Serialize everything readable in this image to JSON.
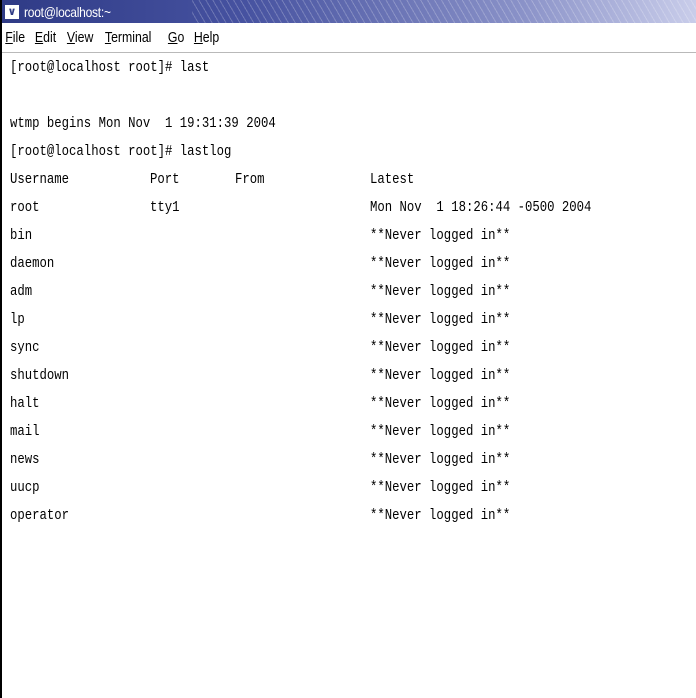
{
  "window": {
    "title": "root@localhost:~",
    "menu_icon": "chevron-down-icon"
  },
  "menubar": {
    "items": [
      {
        "label": "File",
        "mnemonic": "F",
        "rest": "ile"
      },
      {
        "label": "Edit",
        "mnemonic": "E",
        "rest": "dit"
      },
      {
        "label": "View",
        "mnemonic": "V",
        "rest": "iew"
      },
      {
        "label": "Terminal",
        "mnemonic": "T",
        "rest": "erminal"
      },
      {
        "label": "Go",
        "mnemonic": "G",
        "rest": "o"
      },
      {
        "label": "Help",
        "mnemonic": "H",
        "rest": "elp"
      }
    ]
  },
  "terminal": {
    "line1": "[root@localhost root]# last",
    "line2": "",
    "line3": "wtmp begins Mon Nov  1 19:31:39 2004",
    "line4": "[root@localhost root]# lastlog",
    "table": {
      "headers": {
        "username": "Username",
        "port": "Port",
        "from": "From",
        "latest": "Latest"
      },
      "rows": [
        {
          "username": "root",
          "port": "tty1",
          "from": "",
          "latest": "Mon Nov  1 18:26:44 -0500 2004"
        },
        {
          "username": "bin",
          "port": "",
          "from": "",
          "latest": "**Never logged in**"
        },
        {
          "username": "daemon",
          "port": "",
          "from": "",
          "latest": "**Never logged in**"
        },
        {
          "username": "adm",
          "port": "",
          "from": "",
          "latest": "**Never logged in**"
        },
        {
          "username": "lp",
          "port": "",
          "from": "",
          "latest": "**Never logged in**"
        },
        {
          "username": "sync",
          "port": "",
          "from": "",
          "latest": "**Never logged in**"
        },
        {
          "username": "shutdown",
          "port": "",
          "from": "",
          "latest": "**Never logged in**"
        },
        {
          "username": "halt",
          "port": "",
          "from": "",
          "latest": "**Never logged in**"
        },
        {
          "username": "mail",
          "port": "",
          "from": "",
          "latest": "**Never logged in**"
        },
        {
          "username": "news",
          "port": "",
          "from": "",
          "latest": "**Never logged in**"
        },
        {
          "username": "uucp",
          "port": "",
          "from": "",
          "latest": "**Never logged in**"
        },
        {
          "username": "operator",
          "port": "",
          "from": "",
          "latest": "**Never logged in**"
        }
      ]
    }
  }
}
